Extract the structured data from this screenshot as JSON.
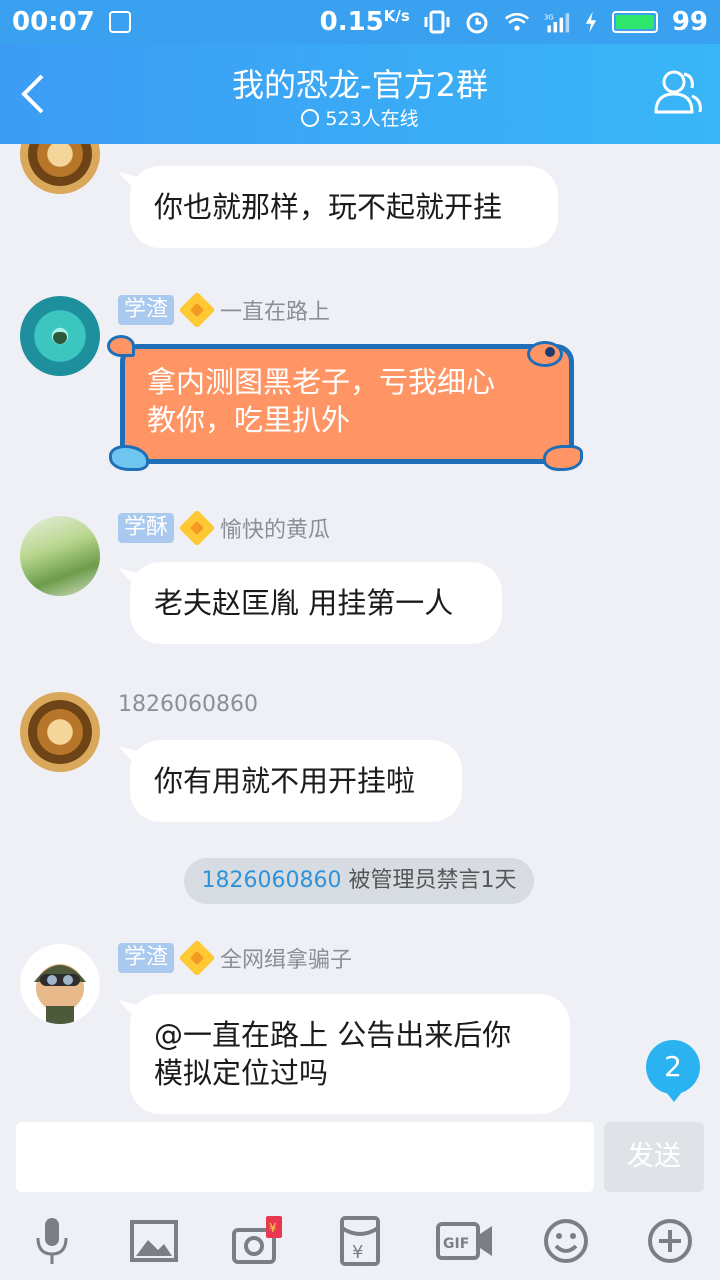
{
  "statusbar": {
    "time": "00:07",
    "speed": "0.15",
    "speed_unit": "K/s",
    "signal_label": "3G",
    "battery": "99"
  },
  "header": {
    "title": "我的恐龙-官方2群",
    "online": "523人在线"
  },
  "messages": [
    {
      "text": "你也就那样，玩不起就开挂"
    },
    {
      "tag": "学渣",
      "sender": "一直在路上",
      "text_line1": "拿内测图黑老子，亏我细心",
      "text_line2": "教你，吃里扒外"
    },
    {
      "tag": "学酥",
      "sender": "愉快的黄瓜",
      "text": "老夫赵匡胤 用挂第一人"
    },
    {
      "sender": "1826060860",
      "text": "你有用就不用开挂啦"
    },
    {
      "tag": "学渣",
      "sender": "全网缉拿骗子",
      "text_line1": "@一直在路上 公告出来后你",
      "text_line2": "模拟定位过吗"
    }
  ],
  "system_notice": {
    "user": "1826060860",
    "text": " 被管理员禁言1天"
  },
  "unread_count": "2",
  "input": {
    "value": "",
    "send_label": "发送"
  },
  "toolbar": {
    "icons": [
      "microphone-icon",
      "image-icon",
      "camera-icon",
      "red-packet-icon",
      "gif-icon",
      "emoji-icon",
      "plus-icon"
    ],
    "redpacket_glyph": "¥"
  },
  "colors": {
    "header": "#3aa0f0",
    "background": "#eef0f5",
    "accent": "#2bb2f0",
    "tag": "#a9c9ef"
  }
}
